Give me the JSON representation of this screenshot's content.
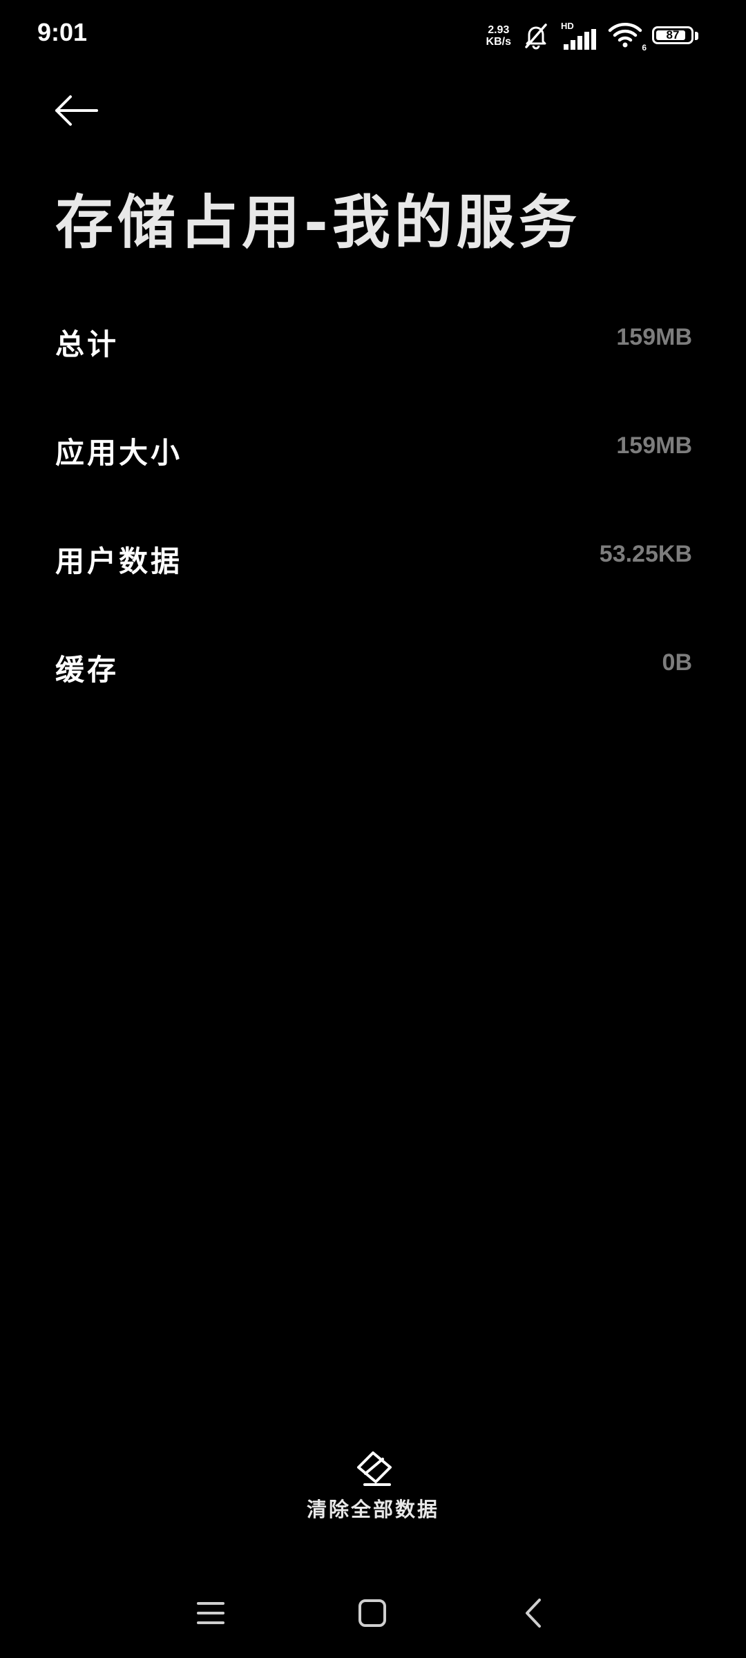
{
  "status_bar": {
    "time": "9:01",
    "net_speed_value": "2.93",
    "net_speed_unit": "KB/s",
    "hd_label": "HD",
    "wifi_badge": "6",
    "battery": "87",
    "battery_level": 0.87,
    "icons": [
      "muted-bell-icon",
      "signal-icon",
      "wifi-icon",
      "battery-icon"
    ]
  },
  "header": {
    "back_icon": "arrow-left-icon",
    "title": "存储占用-我的服务"
  },
  "storage": {
    "items": [
      {
        "label": "总计",
        "value": "159MB"
      },
      {
        "label": "应用大小",
        "value": "159MB"
      },
      {
        "label": "用户数据",
        "value": "53.25KB"
      },
      {
        "label": "缓存",
        "value": "0B"
      }
    ]
  },
  "actions": {
    "clear_icon": "eraser-icon",
    "clear_label": "清除全部数据"
  },
  "nav_bar": {
    "icons": [
      "menu-icon",
      "home-icon",
      "back-icon"
    ]
  },
  "colors": {
    "background": "#000000",
    "text_primary": "#ffffff",
    "text_secondary": "#7d7d7d"
  }
}
